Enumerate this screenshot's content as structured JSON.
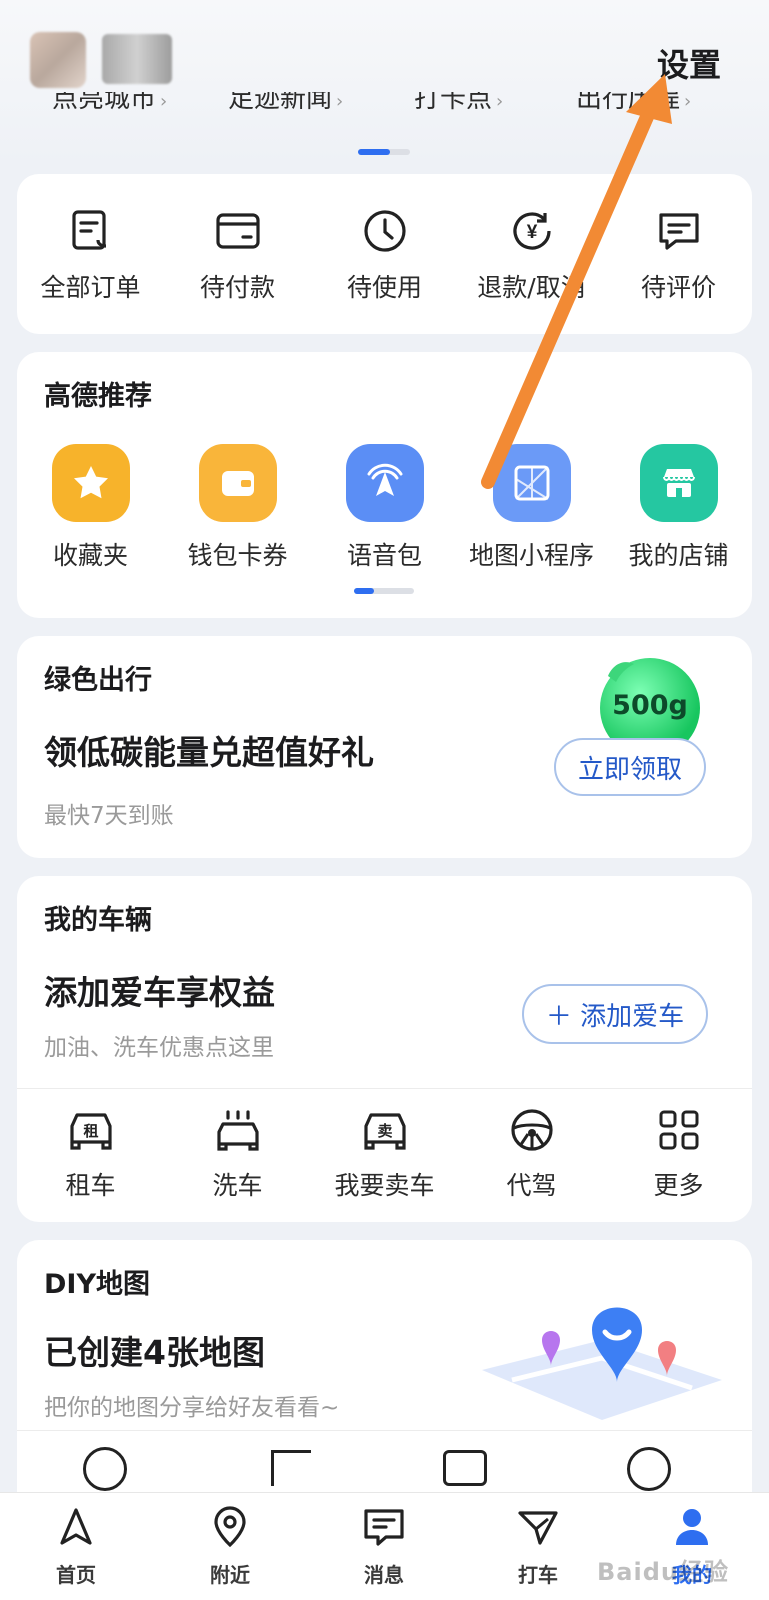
{
  "header": {
    "settings_label": "设置",
    "quick_links": [
      "点亮城市",
      "足迹新闻",
      "打卡点",
      "出行历程"
    ]
  },
  "orders": {
    "items": [
      {
        "label": "全部订单",
        "icon": "order-list-icon"
      },
      {
        "label": "待付款",
        "icon": "wallet-icon"
      },
      {
        "label": "待使用",
        "icon": "clock-icon"
      },
      {
        "label": "退款/取消",
        "icon": "refund-icon"
      },
      {
        "label": "待评价",
        "icon": "comment-icon"
      }
    ]
  },
  "recommend": {
    "title": "高德推荐",
    "items": [
      {
        "label": "收藏夹",
        "icon": "star-icon",
        "color": "#f7b32b"
      },
      {
        "label": "钱包卡券",
        "icon": "wallet-icon",
        "color": "#f9b53a"
      },
      {
        "label": "语音包",
        "icon": "voice-icon",
        "color": "#5b8ef5"
      },
      {
        "label": "地图小程序",
        "icon": "mini-program-icon",
        "color": "#6b9af7"
      },
      {
        "label": "我的店铺",
        "icon": "shop-icon",
        "color": "#25c7a1"
      }
    ]
  },
  "green_travel": {
    "title": "绿色出行",
    "headline": "领低碳能量兑超值好礼",
    "subtitle": "最快7天到账",
    "badge": "500g",
    "button": "立即领取"
  },
  "vehicle": {
    "title": "我的车辆",
    "headline": "添加爱车享权益",
    "subtitle": "加油、洗车优惠点这里",
    "button": "＋ 添加爱车",
    "services": [
      {
        "label": "租车",
        "icon": "rent-car-icon"
      },
      {
        "label": "洗车",
        "icon": "car-wash-icon"
      },
      {
        "label": "我要卖车",
        "icon": "sell-car-icon"
      },
      {
        "label": "代驾",
        "icon": "steering-wheel-icon"
      },
      {
        "label": "更多",
        "icon": "grid-icon"
      }
    ],
    "rent_glyph": "租",
    "sell_glyph": "卖"
  },
  "diy_map": {
    "title": "DIY地图",
    "headline": "已创建4张地图",
    "subtitle": "把你的地图分享给好友看看~"
  },
  "tabbar": {
    "tabs": [
      {
        "label": "首页",
        "icon": "navigate-icon"
      },
      {
        "label": "附近",
        "icon": "location-pin-icon"
      },
      {
        "label": "消息",
        "icon": "message-icon"
      },
      {
        "label": "打车",
        "icon": "taxi-icon"
      },
      {
        "label": "我的",
        "icon": "profile-icon"
      }
    ],
    "active_index": 4
  },
  "watermark": "Baidu经验",
  "colors": {
    "accent": "#2e6ef0",
    "annotation_arrow": "#f28a34"
  }
}
